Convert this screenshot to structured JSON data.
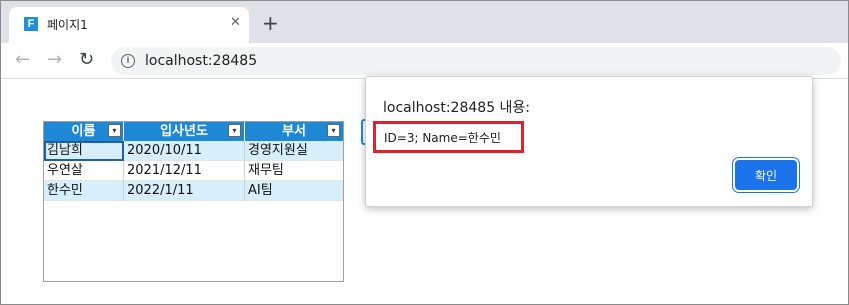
{
  "tab": {
    "favicon_letter": "F",
    "title": "페이지1",
    "close_glyph": "✕",
    "new_tab_glyph": "+"
  },
  "toolbar": {
    "back_glyph": "←",
    "forward_glyph": "→",
    "reload_glyph": "↻",
    "info_glyph": "i",
    "url": "localhost:28485"
  },
  "grid": {
    "headers": [
      "이름",
      "입사년도",
      "부서"
    ],
    "dropdown_glyph": "▾",
    "rows": [
      [
        "김남희",
        "2020/10/11",
        "경영지원실"
      ],
      [
        "우연살",
        "2021/12/11",
        "재무팀"
      ],
      [
        "한수민",
        "2022/1/11",
        "AI팀"
      ]
    ]
  },
  "dialog": {
    "title": "localhost:28485 내용:",
    "message": "ID=3; Name=한수민",
    "ok_label": "확인"
  },
  "colors": {
    "header": "#1e88d4",
    "row_alt": "#d6effa",
    "ok_button": "#1a73e8",
    "highlight": "#e0202a"
  }
}
